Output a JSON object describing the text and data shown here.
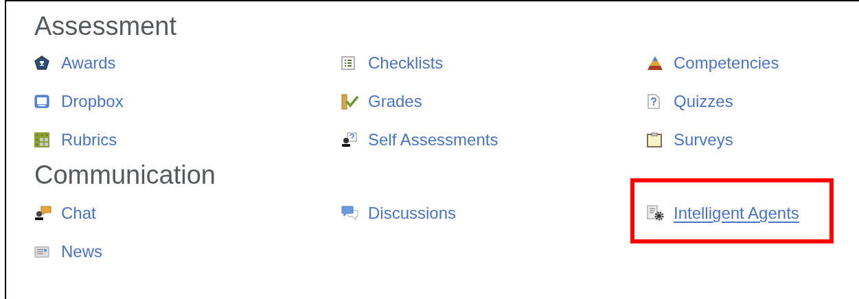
{
  "sections": [
    {
      "title": "Assessment",
      "items": [
        {
          "label": "Awards",
          "kind": "award",
          "underlined": false,
          "highlighted": false
        },
        {
          "label": "Checklists",
          "kind": "checklist",
          "underlined": false,
          "highlighted": false
        },
        {
          "label": "Competencies",
          "kind": "pyramid",
          "underlined": false,
          "highlighted": false
        },
        {
          "label": "Dropbox",
          "kind": "monitor",
          "underlined": false,
          "highlighted": false
        },
        {
          "label": "Grades",
          "kind": "grades",
          "underlined": false,
          "highlighted": false
        },
        {
          "label": "Quizzes",
          "kind": "quiz",
          "underlined": false,
          "highlighted": false
        },
        {
          "label": "Rubrics",
          "kind": "rubric",
          "underlined": false,
          "highlighted": false
        },
        {
          "label": "Self Assessments",
          "kind": "self",
          "underlined": false,
          "highlighted": false
        },
        {
          "label": "Surveys",
          "kind": "clipboard",
          "underlined": false,
          "highlighted": false
        }
      ]
    },
    {
      "title": "Communication",
      "items": [
        {
          "label": "Chat",
          "kind": "chat",
          "underlined": false,
          "highlighted": false
        },
        {
          "label": "Discussions",
          "kind": "discussion",
          "underlined": false,
          "highlighted": false
        },
        {
          "label": "Intelligent Agents",
          "kind": "agent",
          "underlined": true,
          "highlighted": true
        },
        {
          "label": "News",
          "kind": "news",
          "underlined": false,
          "highlighted": false
        }
      ]
    }
  ]
}
